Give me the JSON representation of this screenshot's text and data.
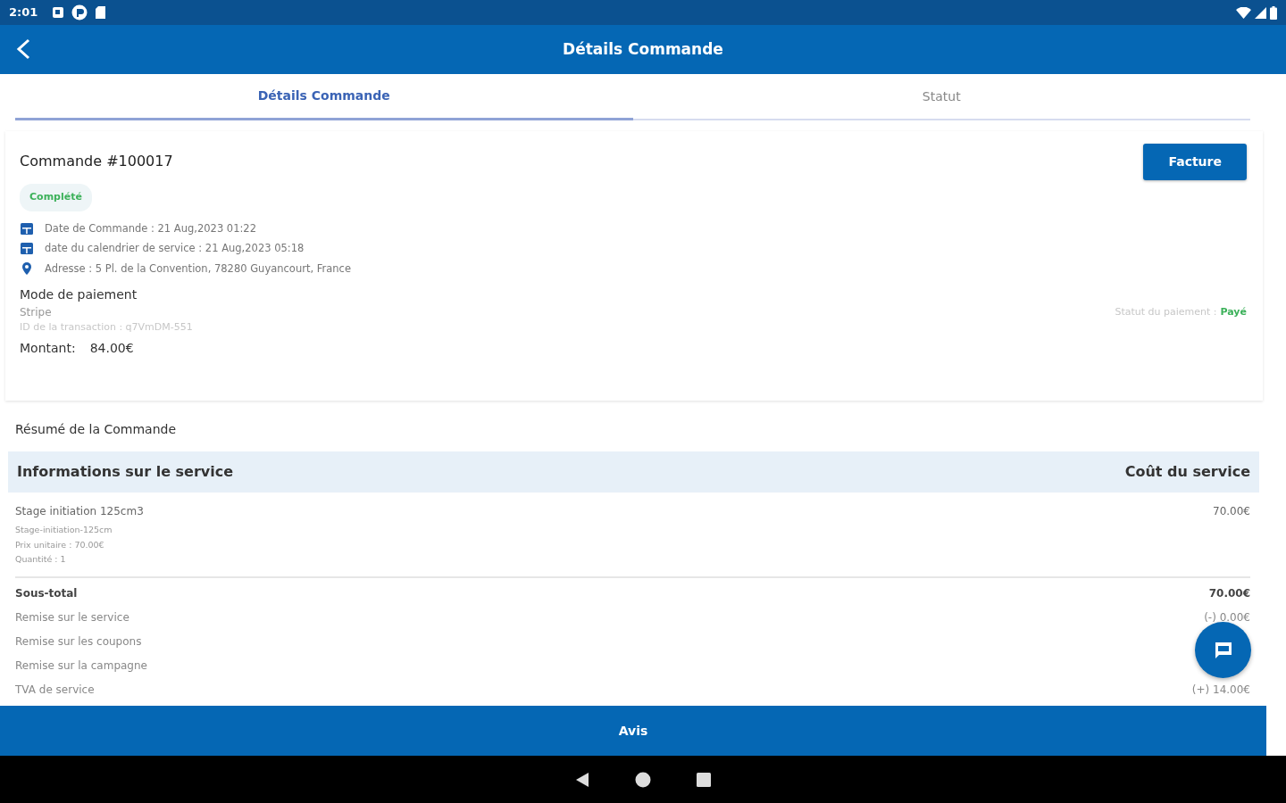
{
  "status_bar": {
    "time": "2:01"
  },
  "app_bar": {
    "title": "Détails Commande"
  },
  "tabs": [
    {
      "label": "Détails Commande",
      "selected": true
    },
    {
      "label": "Statut",
      "selected": false
    }
  ],
  "order": {
    "title": "Commande #100017",
    "invoice_button": "Facture",
    "status_badge": "Complété",
    "details": [
      {
        "kind": "calendar",
        "text": "Date de Commande : 21 Aug,2023 01:22"
      },
      {
        "kind": "calendar",
        "text": "date du calendrier de service : 21 Aug,2023 05:18"
      },
      {
        "kind": "location",
        "text": "Adresse : 5 Pl. de la Convention, 78280 Guyancourt, France"
      }
    ],
    "payment": {
      "heading": "Mode de paiement",
      "method": "Stripe",
      "transaction": "ID de la transaction : q7VmDM-551",
      "status_label": "Statut du paiement :",
      "status_value": "Payé",
      "amount_label": "Montant:",
      "amount_value": "84.00€"
    }
  },
  "summary": {
    "title": "Résumé de la Commande",
    "columns": [
      "Informations sur le service",
      "Coût du service"
    ],
    "items": [
      {
        "name": "Stage initiation 125cm3",
        "slug": "Stage-initiation-125cm",
        "unit_price": "Prix unitaire :  70.00€",
        "quantity": "Quantité :  1",
        "cost": "70.00€"
      }
    ],
    "totals": [
      {
        "label": "Sous-total",
        "value": "70.00€",
        "bold": true
      },
      {
        "label": "Remise sur le service",
        "value": "(-) 0.00€",
        "bold": false
      },
      {
        "label": "Remise sur les coupons",
        "bold": false
      },
      {
        "label": "Remise sur la campagne",
        "bold": false
      },
      {
        "label": "TVA de service",
        "value": "(+) 14.00€",
        "bold": false
      }
    ]
  },
  "bottom_button": "Avis"
}
